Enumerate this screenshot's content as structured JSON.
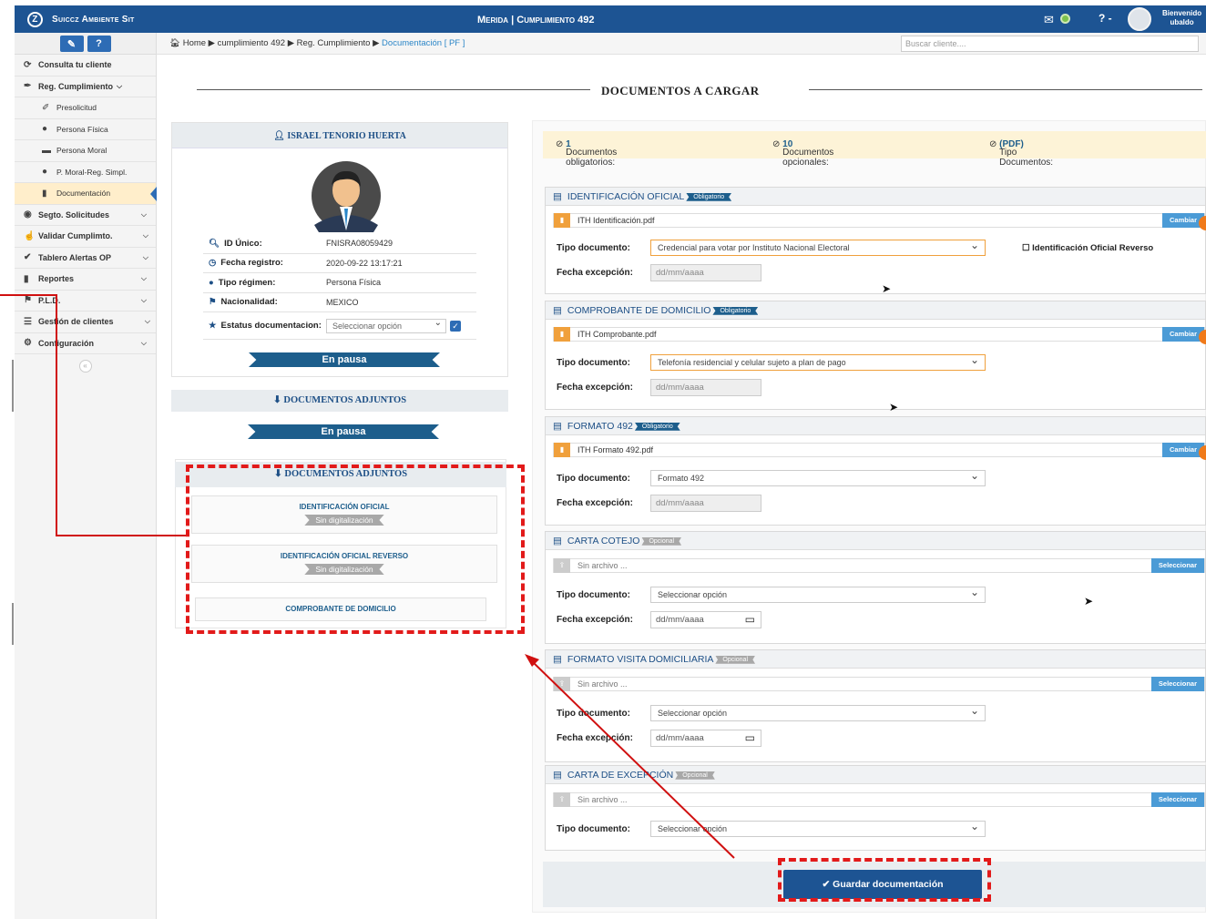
{
  "topbar": {
    "brand": "Suiccz Ambiente Sit",
    "title": "Merida | Cumplimiento 492",
    "help": "? -",
    "welcome_line1": "Bienvenido",
    "welcome_line2": "ubaldo"
  },
  "sidebar": {
    "items": [
      {
        "label": "Consulta tu cliente",
        "icon": "refresh-icon"
      },
      {
        "label": "Reg. Cumplimiento",
        "icon": "pen-icon"
      },
      {
        "label": "Presolicitud",
        "icon": "eraser-icon"
      },
      {
        "label": "Persona Física",
        "icon": "user-icon"
      },
      {
        "label": "Persona Moral",
        "icon": "building-icon"
      },
      {
        "label": "P. Moral-Reg. Simpl.",
        "icon": "user-icon"
      },
      {
        "label": "Documentación",
        "icon": "file-icon"
      },
      {
        "label": "Segto. Solicitudes",
        "icon": "eye-icon"
      },
      {
        "label": "Validar Cumplimto.",
        "icon": "thumbs-up-icon"
      },
      {
        "label": "Tablero Alertas OP",
        "icon": "check-icon"
      },
      {
        "label": "Reportes",
        "icon": "file-icon"
      },
      {
        "label": "P.L.D.",
        "icon": "flag-icon"
      },
      {
        "label": "Gestión de clientes",
        "icon": "list-icon"
      },
      {
        "label": "Configuración",
        "icon": "gear-icon"
      }
    ]
  },
  "breadcrumb": {
    "path": "Home ▶ cumplimiento 492 ▶ Reg. Cumplimiento ▶",
    "current": "Documentación [ PF ]"
  },
  "search": {
    "placeholder": "Buscar cliente...."
  },
  "page": {
    "title": "DOCUMENTOS A CARGAR"
  },
  "profile": {
    "name": "ISRAEL TENORIO HUERTA",
    "fields": [
      {
        "label": "ID Único:",
        "value": "FNISRA08059429"
      },
      {
        "label": "Fecha registro:",
        "value": "2020-09-22 13:17:21"
      },
      {
        "label": "Tipo régimen:",
        "value": "Persona Física"
      },
      {
        "label": "Nacionalidad:",
        "value": "MEXICO"
      }
    ],
    "status_label": "Estatus documentacion:",
    "status_select": "Seleccionar opción",
    "status_badge": "En pausa"
  },
  "attachments": {
    "header": "DOCUMENTOS ADJUNTOS",
    "status_badge": "En pausa",
    "items": [
      {
        "title": "IDENTIFICACIÓN OFICIAL",
        "tag": "Sin digitalización"
      },
      {
        "title": "IDENTIFICACIÓN OFICIAL REVERSO",
        "tag": "Sin digitalización"
      },
      {
        "title": "COMPROBANTE DE DOMICILIO",
        "tag": ""
      }
    ]
  },
  "counts": {
    "required_label": "Documentos obligatorios:",
    "required": "1",
    "optional_label": "Documentos opcionales:",
    "optional": "10",
    "type_label": "Tipo Documentos:",
    "type": "(PDF)"
  },
  "labels": {
    "tipo": "Tipo documento:",
    "fecha": "Fecha excepción:",
    "date_placeholder": "dd/mm/aaaa",
    "reverso": "Identificación Oficial Reverso"
  },
  "documents": [
    {
      "title": "IDENTIFICACIÓN OFICIAL",
      "badge": "Obligatorio",
      "file": "ITH Identificación.pdf",
      "button": "Cambiar",
      "type": "Credencial para votar por Instituto Nacional Electoral"
    },
    {
      "title": "COMPROBANTE DE DOMICILIO",
      "badge": "Obligatorio",
      "file": "ITH Comprobante.pdf",
      "button": "Cambiar",
      "type": "Telefonía residencial y celular sujeto a plan de pago"
    },
    {
      "title": "FORMATO 492",
      "badge": "Obligatorio",
      "file": "ITH Formato 492.pdf",
      "button": "Cambiar",
      "type": "Formato 492"
    },
    {
      "title": "CARTA COTEJO",
      "badge": "Opcional",
      "file": "Sin archivo ...",
      "button": "Seleccionar",
      "type": "Seleccionar opción"
    },
    {
      "title": "FORMATO VISITA DOMICILIARIA",
      "badge": "Opcional",
      "file": "Sin archivo ...",
      "button": "Seleccionar",
      "type": "Seleccionar opción"
    },
    {
      "title": "CARTA DE EXCEPCIÓN",
      "badge": "Opcional",
      "file": "Sin archivo ...",
      "button": "Seleccionar",
      "type": "Seleccionar opción"
    }
  ],
  "save_button": "Guardar documentación",
  "colors": {
    "brand": "#1d5493",
    "highlight": "#e21a1a",
    "accent_orange": "#f0a03c"
  }
}
